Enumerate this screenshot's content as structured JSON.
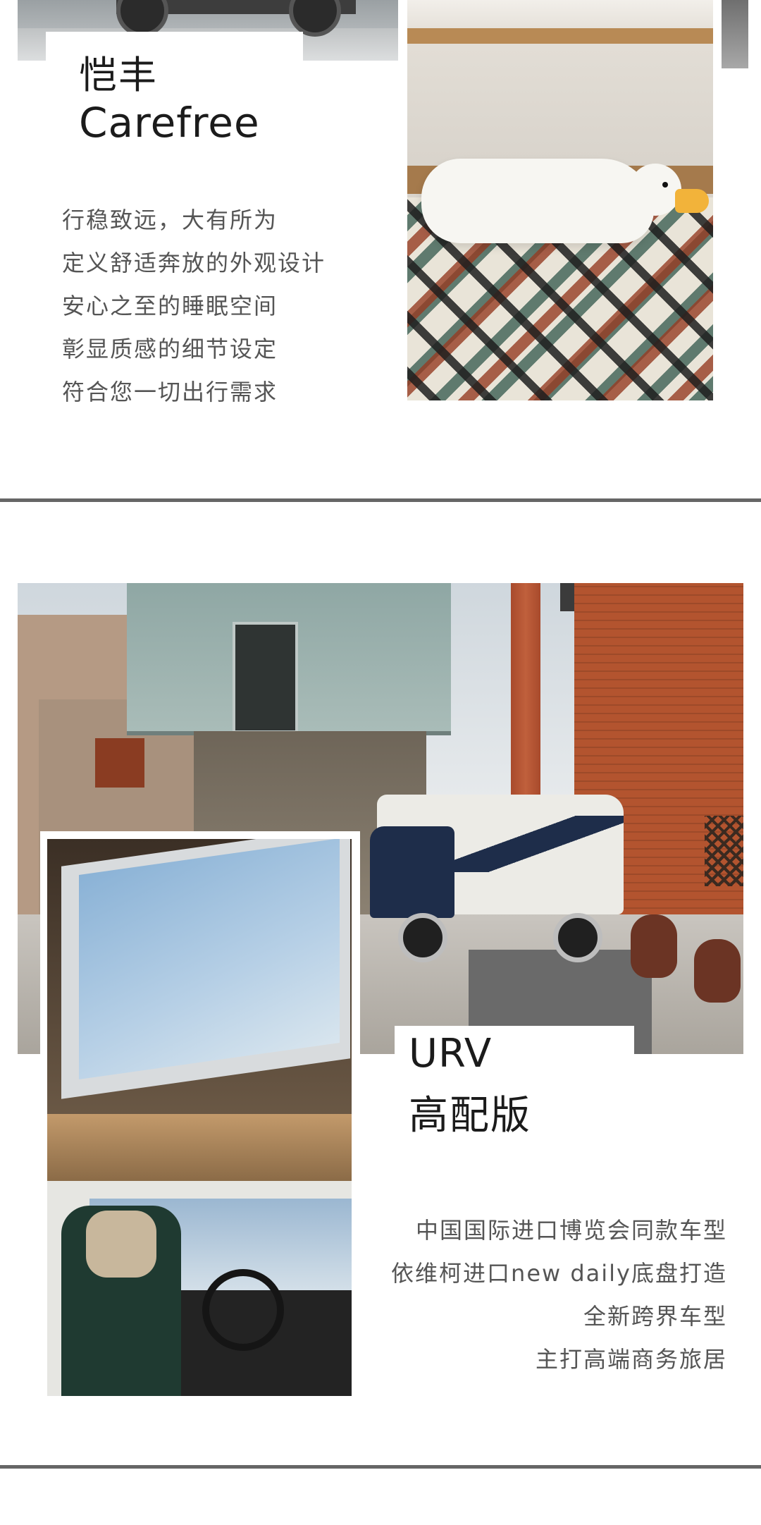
{
  "section1": {
    "title_zh": "恺丰",
    "title_en": "Carefree",
    "lines": [
      "行稳致远，大有所为",
      "定义舒适奔放的外观设计",
      "安心之至的睡眠空间",
      "彰显质感的细节设定",
      "符合您一切出行需求"
    ]
  },
  "section2": {
    "title_en": "URV",
    "title_zh": "高配版",
    "lines": [
      "中国国际进口博览会同款车型",
      "依维柯进口new daily底盘打造",
      "全新跨界车型",
      "主打高端商务旅居"
    ]
  },
  "colors": {
    "divider": "#666666",
    "text_dark": "#1b1b1b",
    "text_body": "#555555",
    "background": "#ffffff"
  }
}
